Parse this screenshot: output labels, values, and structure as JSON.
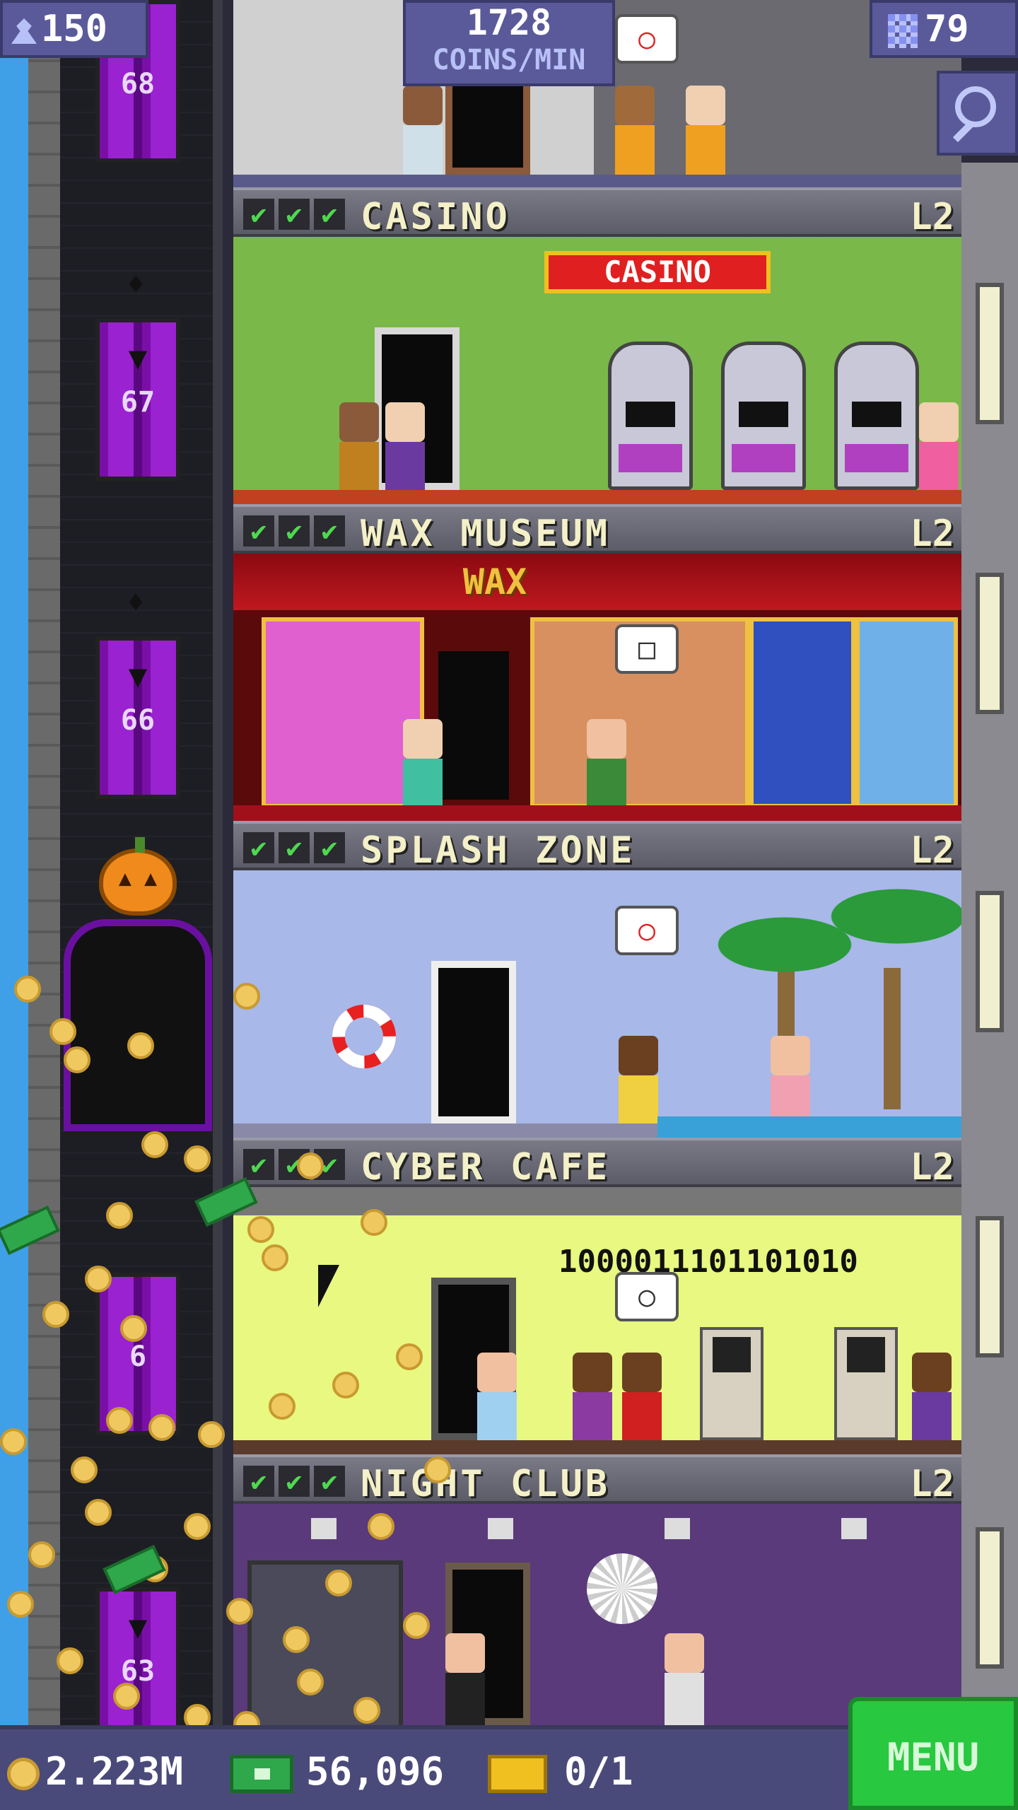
{
  "hud": {
    "population": "150",
    "coin_rate": "1728",
    "coin_rate_unit": "COINS/MIN",
    "floor_count": "79"
  },
  "elevator": {
    "floors": [
      "68",
      "67",
      "66",
      "63"
    ],
    "partial_floor_label": "6"
  },
  "floors": [
    {
      "name": "CASINO",
      "level": "L2",
      "stars": 3,
      "sign": "CASINO"
    },
    {
      "name": "WAX MUSEUM",
      "level": "L2",
      "stars": 3,
      "sign": "WAX"
    },
    {
      "name": "SPLASH ZONE",
      "level": "L2",
      "stars": 3
    },
    {
      "name": "CYBER CAFE",
      "level": "L2",
      "stars": 3,
      "screen_text": "1000011101101010"
    },
    {
      "name": "NIGHT CLUB",
      "level": "L2",
      "stars": 3
    }
  ],
  "bottom_bar": {
    "coins": "2.223M",
    "bux": "56,096",
    "tickets": "0/1",
    "menu_label": "MENU"
  },
  "colors": {
    "hud": "#5a5a9a",
    "menu": "#28c840",
    "coin": "#f0c860",
    "bux": "#2ea84a",
    "elevator": "#9a22d0"
  },
  "icons": [
    "population-icon",
    "grid-icon",
    "zoom-icon",
    "coin-icon",
    "bux-icon",
    "ticket-icon",
    "check-icon",
    "bat-icon",
    "pumpkin-icon",
    "cursor-icon",
    "disco-ball-icon",
    "lifebuoy-icon"
  ]
}
